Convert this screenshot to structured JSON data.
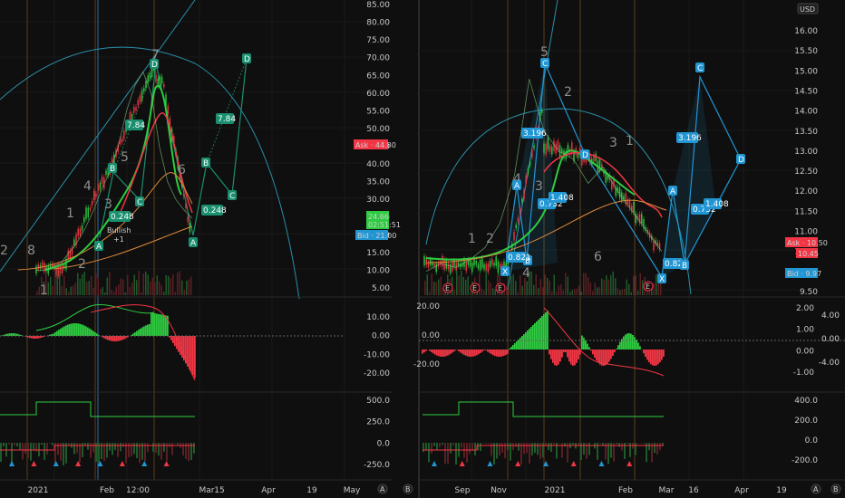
{
  "colors": {
    "background": "#0f0f0f",
    "grid": "#1c1c1c",
    "up": "#2ecc40",
    "down": "#f23645",
    "teal_box": "#1a8f6f",
    "blue_box": "#2196d3",
    "arc": "#2a8fa8",
    "orange": "#e08a3c",
    "ask": "#f23645",
    "bid": "#2196d3",
    "divider": "#2a2a2a"
  },
  "left_panel": {
    "price_axis": [
      "85.00",
      "80.00",
      "75.00",
      "70.00",
      "65.00",
      "60.00",
      "55.00",
      "50.00",
      "45.00",
      "40.00",
      "35.00",
      "30.00",
      "25.00",
      "20.00",
      "15.00",
      "10.00",
      "5.00"
    ],
    "osc1_axis": [
      "10.00",
      "0.00",
      "-10.00",
      "-20.00"
    ],
    "osc2_axis": [
      "500.0",
      "250.0",
      "0.0",
      "-250.0"
    ],
    "time_axis": [
      "2021",
      "Feb",
      "12:00",
      "Mar",
      "15",
      "Apr",
      "19",
      "May"
    ],
    "ask_label": "Ask · 44.80",
    "bid_label": "Bid · 21.00",
    "last_label_1": "24.66",
    "last_label_2": "02:51:51",
    "tags": [
      {
        "text": "D"
      },
      {
        "text": "7.84"
      },
      {
        "text": "B"
      },
      {
        "text": "0.248"
      },
      {
        "text": "C"
      },
      {
        "text": "A"
      },
      {
        "text": "B"
      },
      {
        "text": "7.84"
      },
      {
        "text": "C"
      },
      {
        "text": "0.248"
      },
      {
        "text": "D"
      },
      {
        "text": "A"
      }
    ],
    "wave_labels": [
      "7",
      "5",
      "4",
      "3",
      "1",
      "6",
      "2",
      "8",
      "2",
      "1"
    ],
    "annotation_line1": "Bullish",
    "annotation_line2": "+1"
  },
  "right_panel": {
    "currency": "USD",
    "price_axis": [
      "16.00",
      "15.50",
      "15.00",
      "14.50",
      "14.00",
      "13.50",
      "13.00",
      "12.50",
      "12.00",
      "11.50",
      "11.00",
      "10.50",
      "10.00",
      "9.50"
    ],
    "osc1_axis_inner": [
      "20.00",
      "0.00",
      "-20.00"
    ],
    "osc1_axis": [
      "2.00",
      "1.00",
      "0.00",
      "-1.00"
    ],
    "osc1_axis_far": [
      "4.00",
      "0.00",
      "-4.00"
    ],
    "osc2_axis": [
      "400.0",
      "200.0",
      "0.0",
      "-200.0"
    ],
    "time_axis": [
      "Sep",
      "Nov",
      "2021",
      "Feb",
      "Mar",
      "16",
      "Apr",
      "19"
    ],
    "ask_label": "Ask · 10.50",
    "ask_sub": "10.45",
    "bid_label": "Bid · 9.97",
    "tags": [
      {
        "text": "C"
      },
      {
        "text": "3.196"
      },
      {
        "text": "A"
      },
      {
        "text": "0.732"
      },
      {
        "text": "1.408"
      },
      {
        "text": "D"
      },
      {
        "text": "B"
      },
      {
        "text": "X"
      },
      {
        "text": "C"
      },
      {
        "text": "3.196"
      },
      {
        "text": "A"
      },
      {
        "text": "0.732"
      },
      {
        "text": "1.408"
      },
      {
        "text": "D"
      },
      {
        "text": "0.821"
      },
      {
        "text": "B"
      },
      {
        "text": "X"
      },
      {
        "text": "0.821"
      }
    ],
    "wave_labels": [
      "5",
      "2",
      "3",
      "1",
      "4",
      "3",
      "1",
      "2",
      "6",
      "4"
    ],
    "event_markers": [
      "E",
      "E",
      "E",
      "E"
    ]
  },
  "bottom_icons": [
    "A",
    "B"
  ],
  "chart_data": [
    {
      "type": "line",
      "series": [
        {
          "values": [
            10,
            10,
            11,
            12,
            15,
            18,
            22,
            27,
            33,
            38,
            45,
            55,
            62,
            66,
            60,
            45,
            35,
            30,
            27,
            24.7
          ]
        }
      ],
      "ylim": [
        5,
        85
      ]
    },
    {
      "type": "line",
      "series": [
        {
          "values": [
            10.0,
            10.2,
            10.1,
            10.3,
            10.6,
            11.2,
            12.4,
            14.8,
            13.5,
            13.0,
            12.8,
            12.2,
            12.6,
            12.0,
            11.5,
            11.0,
            10.5
          ]
        }
      ],
      "ylim": [
        9.5,
        16
      ]
    }
  ]
}
